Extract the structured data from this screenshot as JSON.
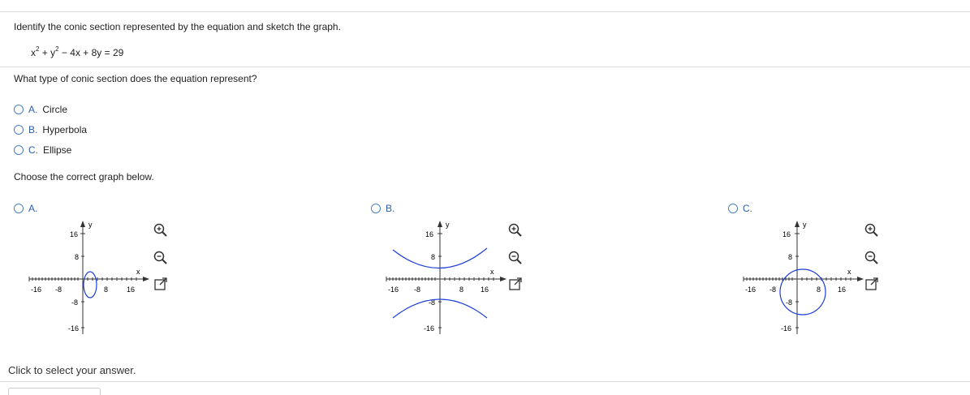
{
  "question": {
    "prompt": "Identify the conic section represented by the equation and sketch the graph.",
    "equation_parts": [
      "x",
      "2",
      " + y",
      "2",
      " − 4x + 8y = 29"
    ],
    "part1_prompt": "What type of conic section does the equation represent?",
    "part1_options": [
      {
        "letter": "A.",
        "label": "Circle"
      },
      {
        "letter": "B.",
        "label": "Hyperbola"
      },
      {
        "letter": "C.",
        "label": "Ellipse"
      }
    ],
    "part2_prompt": "Choose the correct graph below.",
    "graph_options": [
      {
        "letter": "A."
      },
      {
        "letter": "B."
      },
      {
        "letter": "C."
      }
    ]
  },
  "graph_axes": {
    "x_label": "x",
    "y_label": "y",
    "x_ticks": [
      "-16",
      "-8",
      "8",
      "16"
    ],
    "y_ticks": [
      "16",
      "8",
      "-8",
      "-16"
    ]
  },
  "tools": {
    "zoom_in": "zoom-in-icon",
    "zoom_out": "zoom-out-icon",
    "popout": "popout-icon"
  },
  "footer": {
    "status": "Click to select your answer."
  },
  "colors": {
    "accent": "#2d5da8",
    "curve": "#1f3fd6",
    "radio_border": "#4a7fbf"
  }
}
